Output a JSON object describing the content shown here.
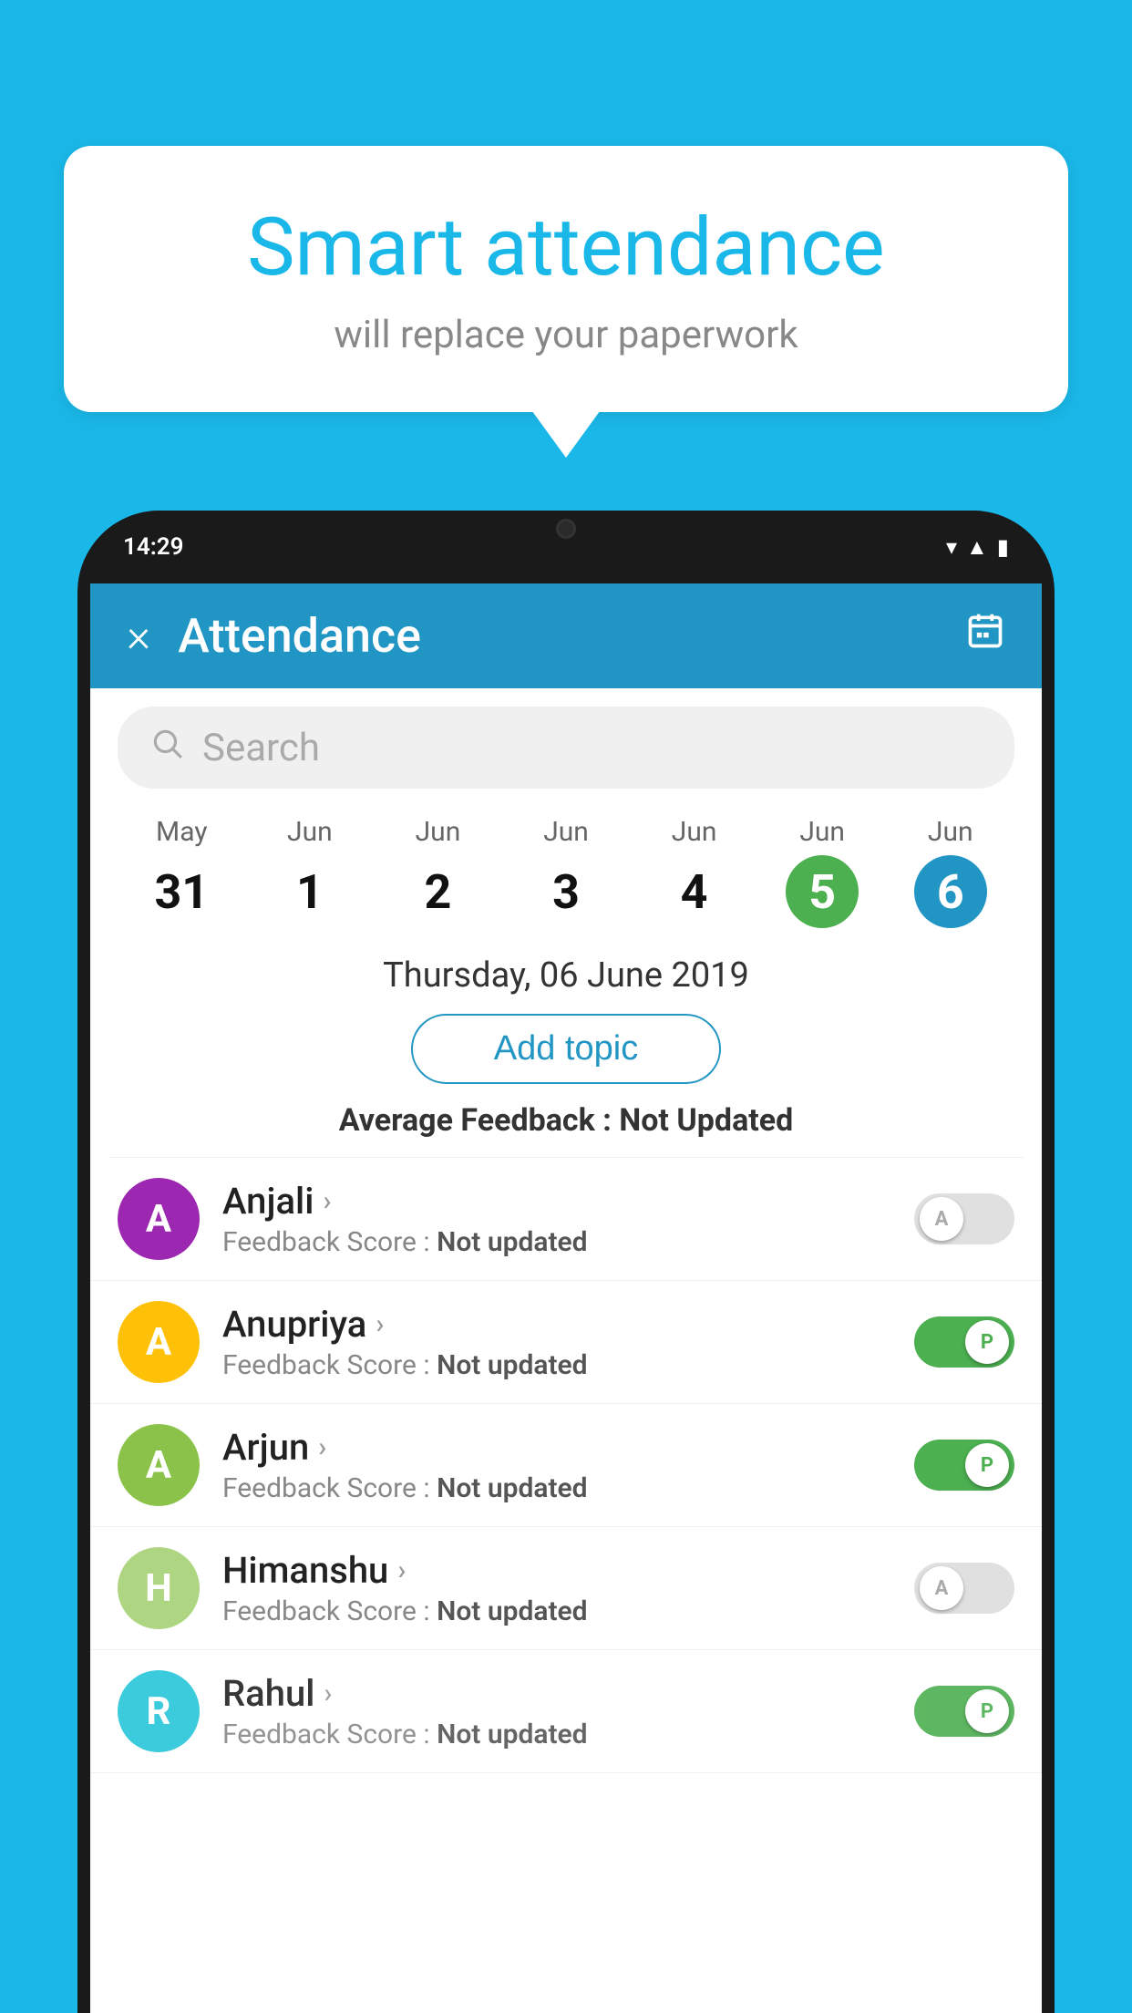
{
  "background_color": "#1ab8e8",
  "speech_bubble": {
    "title": "Smart attendance",
    "subtitle": "will replace your paperwork"
  },
  "status_bar": {
    "time": "14:29",
    "icons": [
      "wifi",
      "signal",
      "battery"
    ]
  },
  "app_header": {
    "title": "Attendance",
    "close_label": "×",
    "calendar_icon": "📅"
  },
  "search": {
    "placeholder": "Search"
  },
  "calendar": {
    "days": [
      {
        "month": "May",
        "date": "31",
        "state": "normal"
      },
      {
        "month": "Jun",
        "date": "1",
        "state": "normal"
      },
      {
        "month": "Jun",
        "date": "2",
        "state": "normal"
      },
      {
        "month": "Jun",
        "date": "3",
        "state": "normal"
      },
      {
        "month": "Jun",
        "date": "4",
        "state": "normal"
      },
      {
        "month": "Jun",
        "date": "5",
        "state": "today"
      },
      {
        "month": "Jun",
        "date": "6",
        "state": "selected"
      }
    ]
  },
  "selected_date": "Thursday, 06 June 2019",
  "add_topic_label": "Add topic",
  "avg_feedback_label": "Average Feedback :",
  "avg_feedback_value": "Not Updated",
  "students": [
    {
      "name": "Anjali",
      "avatar_letter": "A",
      "avatar_color": "#9c27b0",
      "feedback_label": "Feedback Score :",
      "feedback_value": "Not updated",
      "toggle": "off",
      "toggle_letter": "A"
    },
    {
      "name": "Anupriya",
      "avatar_letter": "A",
      "avatar_color": "#ffc107",
      "feedback_label": "Feedback Score :",
      "feedback_value": "Not updated",
      "toggle": "on",
      "toggle_letter": "P"
    },
    {
      "name": "Arjun",
      "avatar_letter": "A",
      "avatar_color": "#8bc34a",
      "feedback_label": "Feedback Score :",
      "feedback_value": "Not updated",
      "toggle": "on",
      "toggle_letter": "P"
    },
    {
      "name": "Himanshu",
      "avatar_letter": "H",
      "avatar_color": "#aed581",
      "feedback_label": "Feedback Score :",
      "feedback_value": "Not updated",
      "toggle": "off",
      "toggle_letter": "A"
    },
    {
      "name": "Rahul",
      "avatar_letter": "R",
      "avatar_color": "#26c6da",
      "feedback_label": "Feedback Score :",
      "feedback_value": "Not updated",
      "toggle": "on",
      "toggle_letter": "P"
    }
  ]
}
